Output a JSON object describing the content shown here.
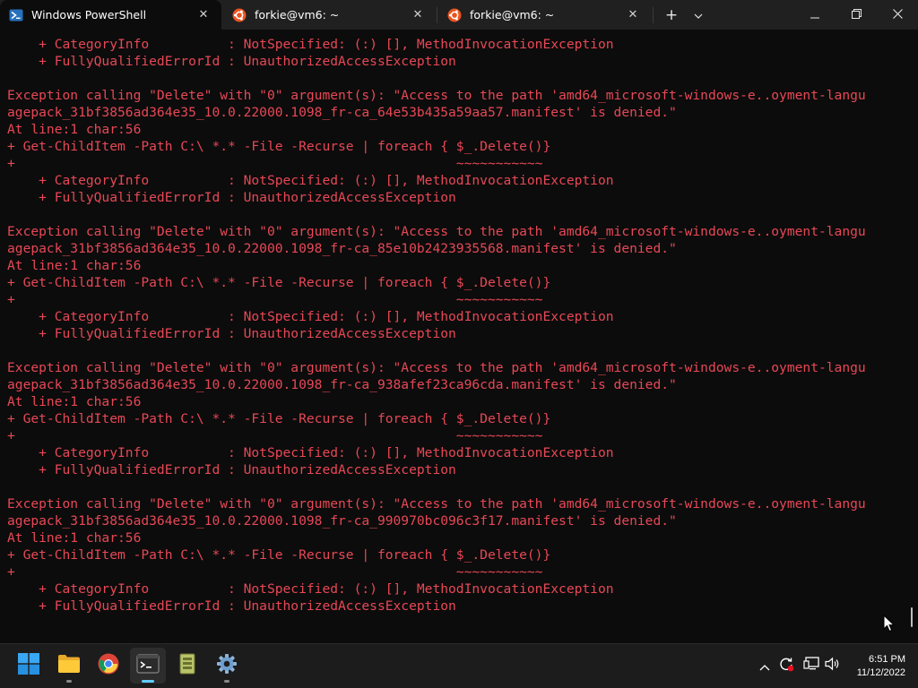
{
  "window": {
    "tabs": [
      {
        "label": "Windows PowerShell",
        "icon": "powershell-icon",
        "active": true
      },
      {
        "label": "forkie@vm6: ~",
        "icon": "ubuntu-icon",
        "active": false
      },
      {
        "label": "forkie@vm6: ~",
        "icon": "ubuntu-icon",
        "active": false
      }
    ],
    "new_tab_label": "+",
    "dropdown_icon": "chevron-down-icon",
    "controls": [
      "minimize-icon",
      "maximize-icon",
      "close-icon"
    ]
  },
  "terminal": {
    "text_color": "#e74856",
    "background": "#0c0c0c",
    "lines": [
      "    + CategoryInfo          : NotSpecified: (:) [], MethodInvocationException",
      "    + FullyQualifiedErrorId : UnauthorizedAccessException",
      "",
      "Exception calling \"Delete\" with \"0\" argument(s): \"Access to the path 'amd64_microsoft-windows-e..oyment-langu",
      "agepack_31bf3856ad364e35_10.0.22000.1098_fr-ca_64e53b435a59aa57.manifest' is denied.\"",
      "At line:1 char:56",
      "+ Get-ChildItem -Path C:\\ *.* -File -Recurse | foreach { $_.Delete()}",
      "+                                                        ~~~~~~~~~~~",
      "    + CategoryInfo          : NotSpecified: (:) [], MethodInvocationException",
      "    + FullyQualifiedErrorId : UnauthorizedAccessException",
      "",
      "Exception calling \"Delete\" with \"0\" argument(s): \"Access to the path 'amd64_microsoft-windows-e..oyment-langu",
      "agepack_31bf3856ad364e35_10.0.22000.1098_fr-ca_85e10b2423935568.manifest' is denied.\"",
      "At line:1 char:56",
      "+ Get-ChildItem -Path C:\\ *.* -File -Recurse | foreach { $_.Delete()}",
      "+                                                        ~~~~~~~~~~~",
      "    + CategoryInfo          : NotSpecified: (:) [], MethodInvocationException",
      "    + FullyQualifiedErrorId : UnauthorizedAccessException",
      "",
      "Exception calling \"Delete\" with \"0\" argument(s): \"Access to the path 'amd64_microsoft-windows-e..oyment-langu",
      "agepack_31bf3856ad364e35_10.0.22000.1098_fr-ca_938afef23ca96cda.manifest' is denied.\"",
      "At line:1 char:56",
      "+ Get-ChildItem -Path C:\\ *.* -File -Recurse | foreach { $_.Delete()}",
      "+                                                        ~~~~~~~~~~~",
      "    + CategoryInfo          : NotSpecified: (:) [], MethodInvocationException",
      "    + FullyQualifiedErrorId : UnauthorizedAccessException",
      "",
      "Exception calling \"Delete\" with \"0\" argument(s): \"Access to the path 'amd64_microsoft-windows-e..oyment-langu",
      "agepack_31bf3856ad364e35_10.0.22000.1098_fr-ca_990970bc096c3f17.manifest' is denied.\"",
      "At line:1 char:56",
      "+ Get-ChildItem -Path C:\\ *.* -File -Recurse | foreach { $_.Delete()}",
      "+                                                        ~~~~~~~~~~~",
      "    + CategoryInfo          : NotSpecified: (:) [], MethodInvocationException",
      "    + FullyQualifiedErrorId : UnauthorizedAccessException"
    ]
  },
  "taskbar": {
    "apps": [
      {
        "name": "start-button",
        "icon": "windows-logo-icon"
      },
      {
        "name": "file-explorer",
        "icon": "folder-icon"
      },
      {
        "name": "chrome",
        "icon": "chrome-icon"
      },
      {
        "name": "terminal",
        "icon": "terminal-icon",
        "active": true
      },
      {
        "name": "archive-app",
        "icon": "archive-icon"
      },
      {
        "name": "settings",
        "icon": "gear-icon"
      }
    ],
    "tray": [
      "chevron-up-icon",
      "sync-icon",
      "network-icon",
      "volume-icon"
    ],
    "clock": {
      "time": "6:51 PM",
      "date": "11/12/2022"
    },
    "accent": "#60cdff"
  }
}
